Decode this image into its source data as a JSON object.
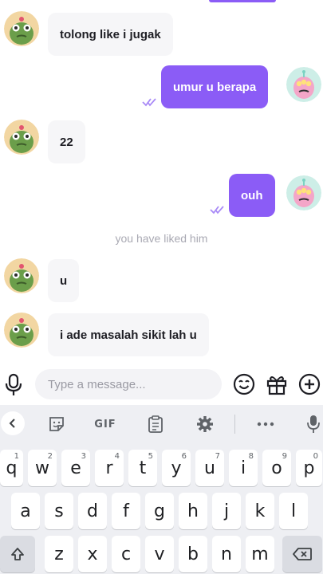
{
  "messages": [
    {
      "side": "in",
      "text": "tolong like i jugak"
    },
    {
      "side": "out",
      "text": "umur u berapa"
    },
    {
      "side": "in",
      "text": "22"
    },
    {
      "side": "out",
      "text": "ouh"
    },
    {
      "side": "in",
      "text": "u"
    },
    {
      "side": "in",
      "text": "i ade masalah sikit lah u"
    }
  ],
  "system_notice": "you have liked him",
  "composer": {
    "placeholder": "Type a message..."
  },
  "keyboard_toolbar": {
    "gif_label": "GIF"
  },
  "keyboard": {
    "row1": [
      {
        "key": "q",
        "hint": "1"
      },
      {
        "key": "w",
        "hint": "2"
      },
      {
        "key": "e",
        "hint": "3"
      },
      {
        "key": "r",
        "hint": "4"
      },
      {
        "key": "t",
        "hint": "5"
      },
      {
        "key": "y",
        "hint": "6"
      },
      {
        "key": "u",
        "hint": "7"
      },
      {
        "key": "i",
        "hint": "8"
      },
      {
        "key": "o",
        "hint": "9"
      },
      {
        "key": "p",
        "hint": "0"
      }
    ],
    "row2": [
      "a",
      "s",
      "d",
      "f",
      "g",
      "h",
      "j",
      "k",
      "l"
    ],
    "row3": [
      "z",
      "x",
      "c",
      "v",
      "b",
      "n",
      "m"
    ]
  },
  "colors": {
    "accent": "#8b5cf6",
    "incoming_bubble": "#f6f6f8",
    "keyboard_bg": "#eeeff3"
  },
  "icons": [
    "microphone-icon",
    "emoji-icon",
    "gift-icon",
    "add-icon",
    "chevron-left-icon",
    "sticker-icon",
    "clipboard-icon",
    "settings-gear-icon",
    "more-dots-icon",
    "shift-icon",
    "backspace-icon",
    "read-receipt-icon"
  ]
}
